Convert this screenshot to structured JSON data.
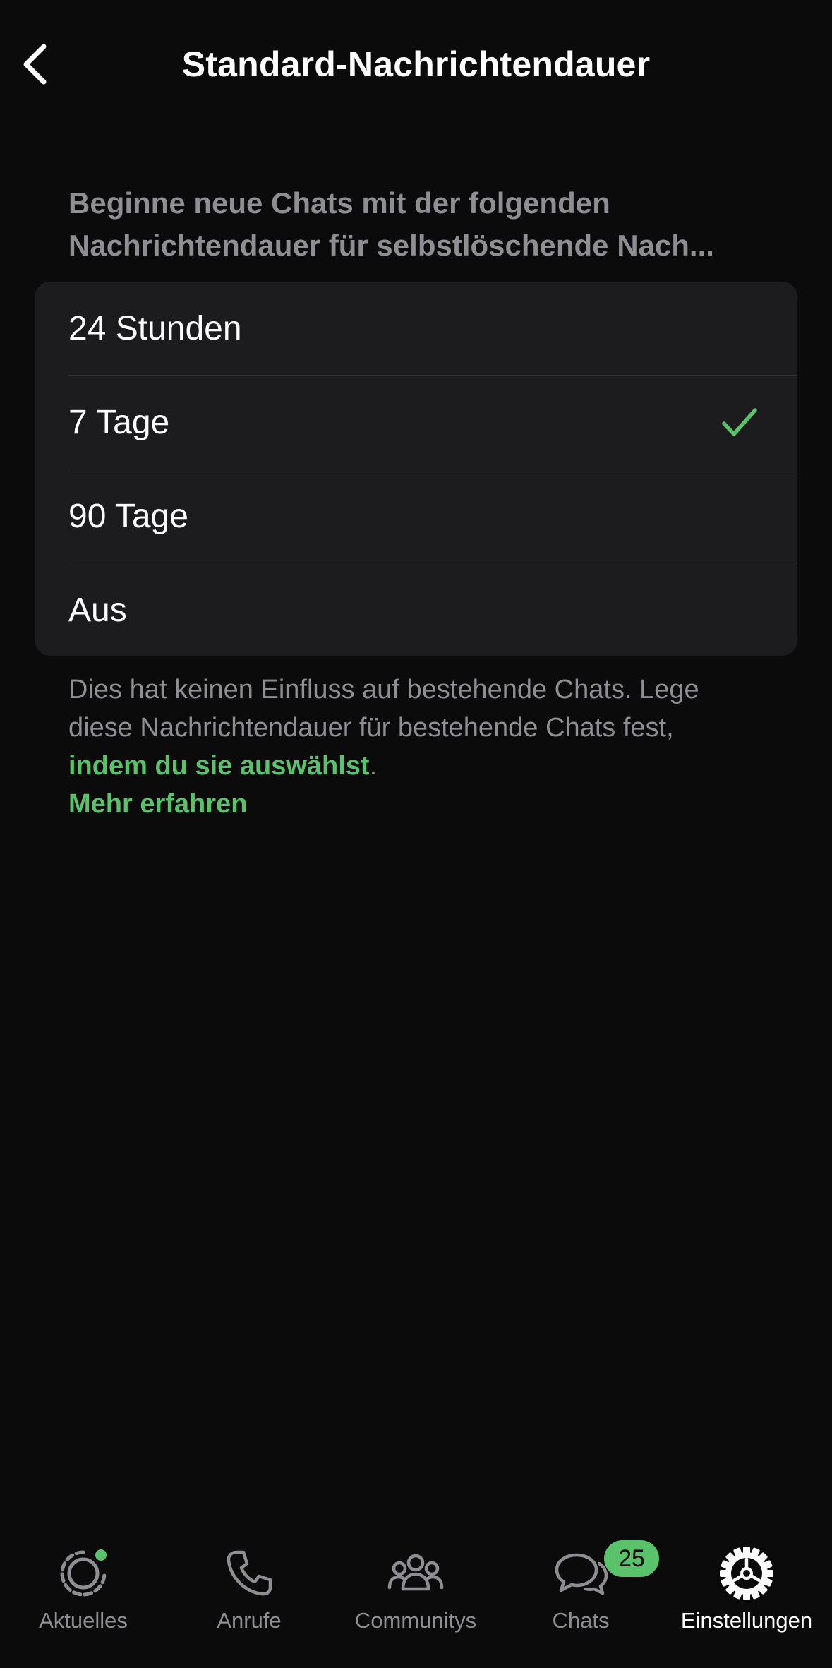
{
  "header": {
    "title": "Standard-Nachrichtendauer"
  },
  "intro": {
    "line1": "Beginne neue Chats mit der folgenden",
    "line2": "Nachrichtendauer für selbstlöschende Nach..."
  },
  "options": {
    "items": [
      {
        "label": "24 Stunden",
        "selected": false
      },
      {
        "label": "7 Tage",
        "selected": true
      },
      {
        "label": "90 Tage",
        "selected": false
      },
      {
        "label": "Aus",
        "selected": false
      }
    ]
  },
  "note": {
    "text_line1": "Dies hat keinen Einfluss auf bestehende Chats. Lege",
    "text_line2": "diese Nachrichtendauer für bestehende Chats fest,",
    "link_text": "indem du sie auswählst",
    "link_suffix": ".",
    "more_link": "Mehr erfahren"
  },
  "tabbar": {
    "tabs": [
      {
        "label": "Aktuelles",
        "icon": "status-icon",
        "active": false
      },
      {
        "label": "Anrufe",
        "icon": "phone-icon",
        "active": false
      },
      {
        "label": "Communitys",
        "icon": "communities-icon",
        "active": false
      },
      {
        "label": "Chats",
        "icon": "chats-icon",
        "active": false
      },
      {
        "label": "Einstellungen",
        "icon": "settings-icon",
        "active": true
      }
    ],
    "chats_badge": "25"
  },
  "colors": {
    "background": "#0b0b0b",
    "card": "#1c1c1e",
    "accent": "#5ac26a",
    "secondary_text": "#8e8e93"
  }
}
